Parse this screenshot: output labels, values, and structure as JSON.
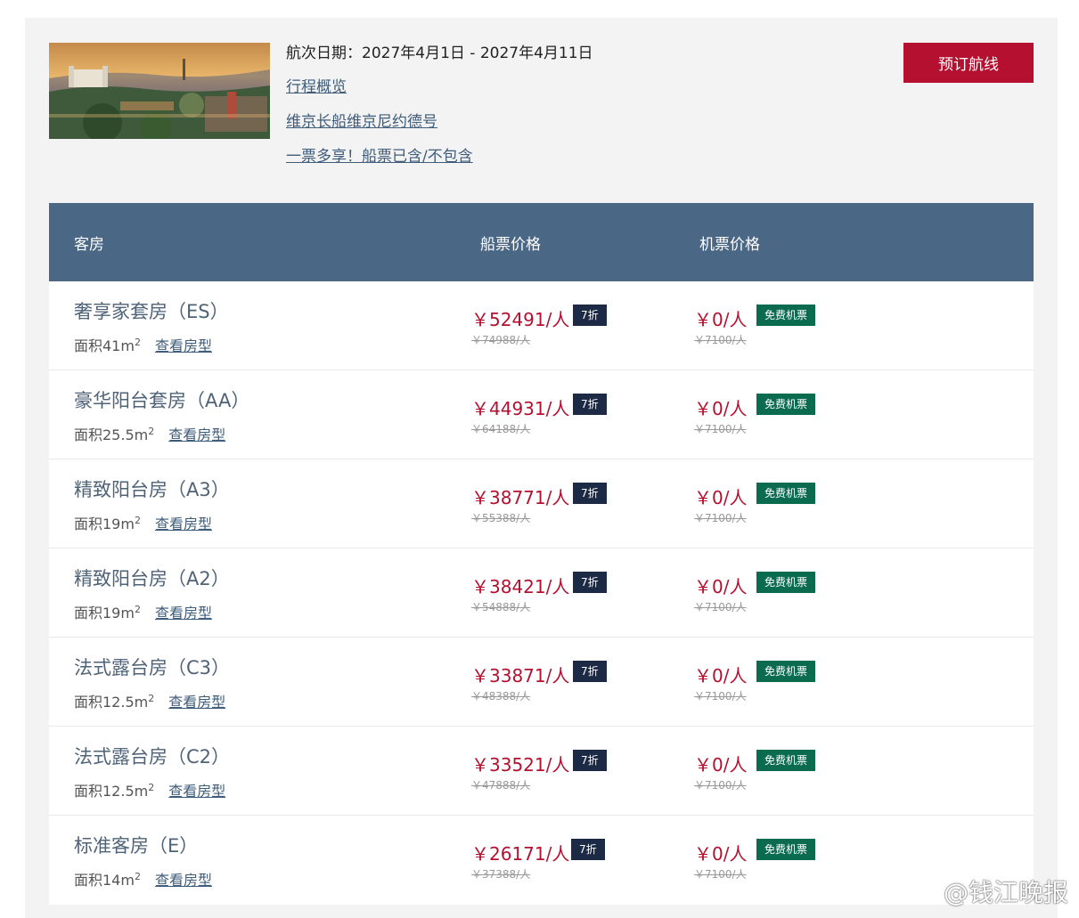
{
  "header": {
    "date_text": "航次日期：2027年4月1日 - 2027年4月11日",
    "links": [
      "行程概览",
      "维京长船维京尼约德号",
      "一票多享！船票已含/不包含"
    ],
    "book_button": "预订航线"
  },
  "table": {
    "columns": [
      "客房",
      "船票价格",
      "机票价格"
    ],
    "view_label": "查看房型",
    "rows": [
      {
        "name": "奢享家套房（ES）",
        "area": "面积41m",
        "fare": "￥52491/人",
        "orig_fare": "￥74988/人",
        "discount": "7折",
        "air": "￥0/人",
        "orig_air": "￥7100/人",
        "air_badge": "免费机票"
      },
      {
        "name": "豪华阳台套房（AA）",
        "area": "面积25.5m",
        "fare": "￥44931/人",
        "orig_fare": "￥64188/人",
        "discount": "7折",
        "air": "￥0/人",
        "orig_air": "￥7100/人",
        "air_badge": "免费机票"
      },
      {
        "name": "精致阳台房（A3）",
        "area": "面积19m",
        "fare": "￥38771/人",
        "orig_fare": "￥55388/人",
        "discount": "7折",
        "air": "￥0/人",
        "orig_air": "￥7100/人",
        "air_badge": "免费机票"
      },
      {
        "name": "精致阳台房（A2）",
        "area": "面积19m",
        "fare": "￥38421/人",
        "orig_fare": "￥54888/人",
        "discount": "7折",
        "air": "￥0/人",
        "orig_air": "￥7100/人",
        "air_badge": "免费机票"
      },
      {
        "name": "法式露台房（C3）",
        "area": "面积12.5m",
        "fare": "￥33871/人",
        "orig_fare": "￥48388/人",
        "discount": "7折",
        "air": "￥0/人",
        "orig_air": "￥7100/人",
        "air_badge": "免费机票"
      },
      {
        "name": "法式露台房（C2）",
        "area": "面积12.5m",
        "fare": "￥33521/人",
        "orig_fare": "￥47888/人",
        "discount": "7折",
        "air": "￥0/人",
        "orig_air": "￥7100/人",
        "air_badge": "免费机票"
      },
      {
        "name": "标准客房（E）",
        "area": "面积14m",
        "fare": "￥26171/人",
        "orig_fare": "￥37388/人",
        "discount": "7折",
        "air": "￥0/人",
        "orig_air": "￥7100/人",
        "air_badge": "免费机票"
      }
    ]
  },
  "watermark": "@钱江晚报",
  "colors": {
    "header_bg": "#4a6786",
    "price": "#b5102f",
    "discount_badge": "#1c2a45",
    "free_badge": "#0b6b4f",
    "button": "#b5102f"
  }
}
